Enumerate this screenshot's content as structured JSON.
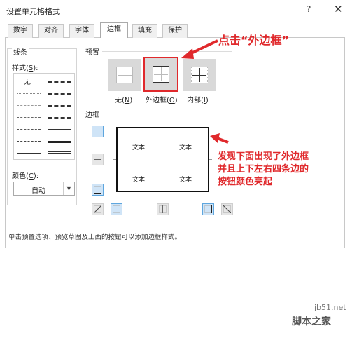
{
  "dialog": {
    "title": "设置单元格格式",
    "help": "?",
    "close": "✕"
  },
  "tabs": [
    {
      "label": "数字"
    },
    {
      "label": "对齐"
    },
    {
      "label": "字体"
    },
    {
      "label": "边框"
    },
    {
      "label": "填充"
    },
    {
      "label": "保护"
    }
  ],
  "line": {
    "group_label": "线条",
    "style_label": "样式(",
    "style_key": "S",
    "style_suffix": "):",
    "none_label": "无",
    "color_label": "颜色(",
    "color_key": "C",
    "color_suffix": "):",
    "color_value": "自动"
  },
  "presets": {
    "section_label": "预置",
    "none": {
      "label": "无(",
      "key": "N",
      "suffix": ")"
    },
    "outline": {
      "label": "外边框(",
      "key": "O",
      "suffix": ")"
    },
    "inside": {
      "label": "内部(",
      "key": "I",
      "suffix": ")"
    }
  },
  "border": {
    "section_label": "边框",
    "preview_text": [
      "文本",
      "文本",
      "文本",
      "文本"
    ]
  },
  "footer": "单击预置选项、预览草图及上面的按钮可以添加边框样式。",
  "annotations": {
    "top": "点击“外边框”",
    "side": [
      "发现下面出现了外边框",
      "并且上下左右四条边的",
      "按钮颜色亮起"
    ]
  },
  "watermark": {
    "url": "jb51.net",
    "name": "脚本之家"
  },
  "colors": {
    "accent": "#e0292c",
    "button_on": "#cfe4f7"
  },
  "border_buttons": {
    "top": "on",
    "middle_horizontal": "off",
    "bottom": "on",
    "diag_up": "off",
    "left": "on",
    "middle_vertical": "off",
    "right": "on",
    "diag_down": "off"
  }
}
